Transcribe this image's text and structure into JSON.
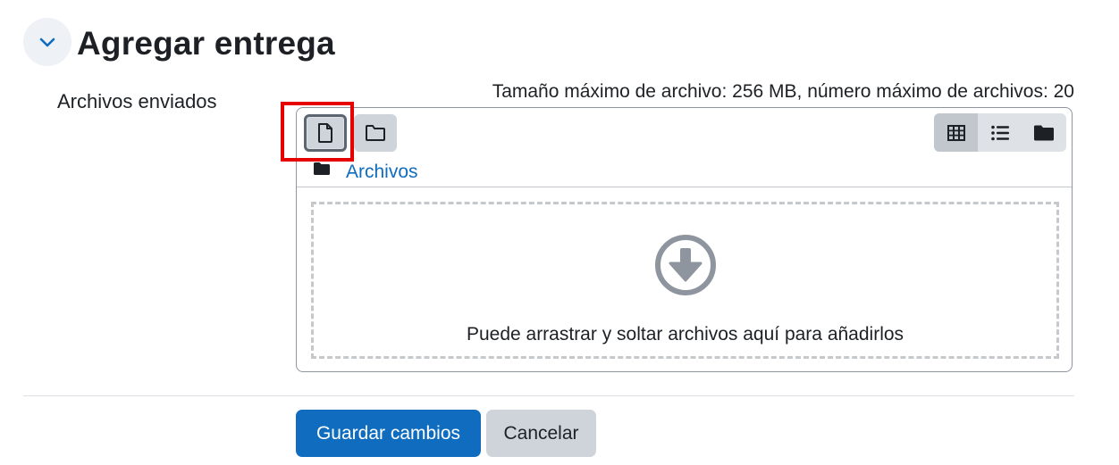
{
  "section": {
    "title": "Agregar entrega",
    "toggle_icon": "chevron-down-icon"
  },
  "field": {
    "label": "Archivos enviados",
    "max_info": "Tamaño máximo de archivo: 256 MB, número máximo de archivos: 20"
  },
  "filemanager": {
    "toolbar": {
      "add_file_icon": "file-icon",
      "create_folder_icon": "folder-outline-icon",
      "views": [
        {
          "icon": "grid-view-icon",
          "active": true
        },
        {
          "icon": "list-view-icon",
          "active": false
        },
        {
          "icon": "folder-view-icon",
          "active": false
        }
      ]
    },
    "path": {
      "icon": "folder-icon",
      "label": "Archivos"
    },
    "dropzone": {
      "icon": "download-circle-icon",
      "text": "Puede arrastrar y soltar archivos aquí para añadirlos"
    }
  },
  "actions": {
    "save_label": "Guardar cambios",
    "cancel_label": "Cancelar"
  },
  "colors": {
    "primary": "#0f6cbf",
    "link": "#0f6cbf",
    "highlight": "#e60000",
    "secondary_button": "#ced4da"
  }
}
